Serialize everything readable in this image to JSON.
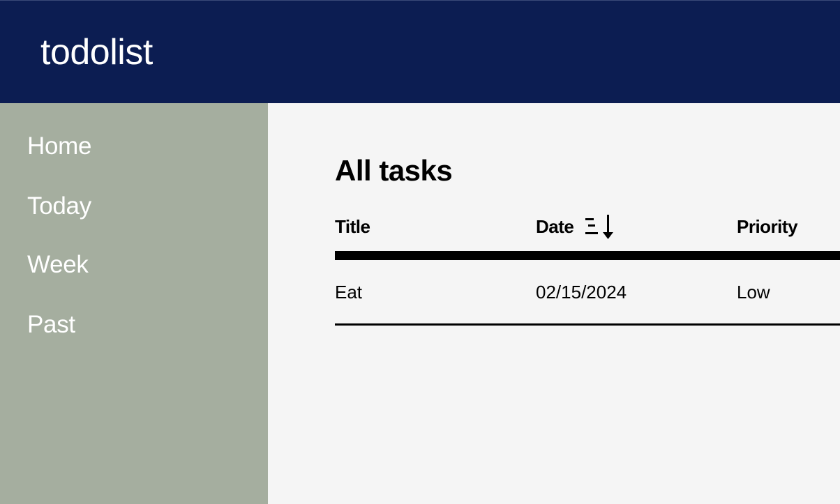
{
  "app": {
    "title": "todolist"
  },
  "sidebar": {
    "items": [
      {
        "label": "Home"
      },
      {
        "label": "Today"
      },
      {
        "label": "Week"
      },
      {
        "label": "Past"
      }
    ]
  },
  "main": {
    "page_title": "All tasks",
    "table": {
      "columns": [
        "Title",
        "Date",
        "Priority"
      ],
      "sort_icon": "sort-descending-icon",
      "rows": [
        {
          "title": "Eat",
          "date": "02/15/2024",
          "priority": "Low"
        }
      ]
    }
  },
  "colors": {
    "header_bg": "#0c1d52",
    "sidebar_bg": "#a5ae9f",
    "main_bg": "#f5f5f5"
  }
}
